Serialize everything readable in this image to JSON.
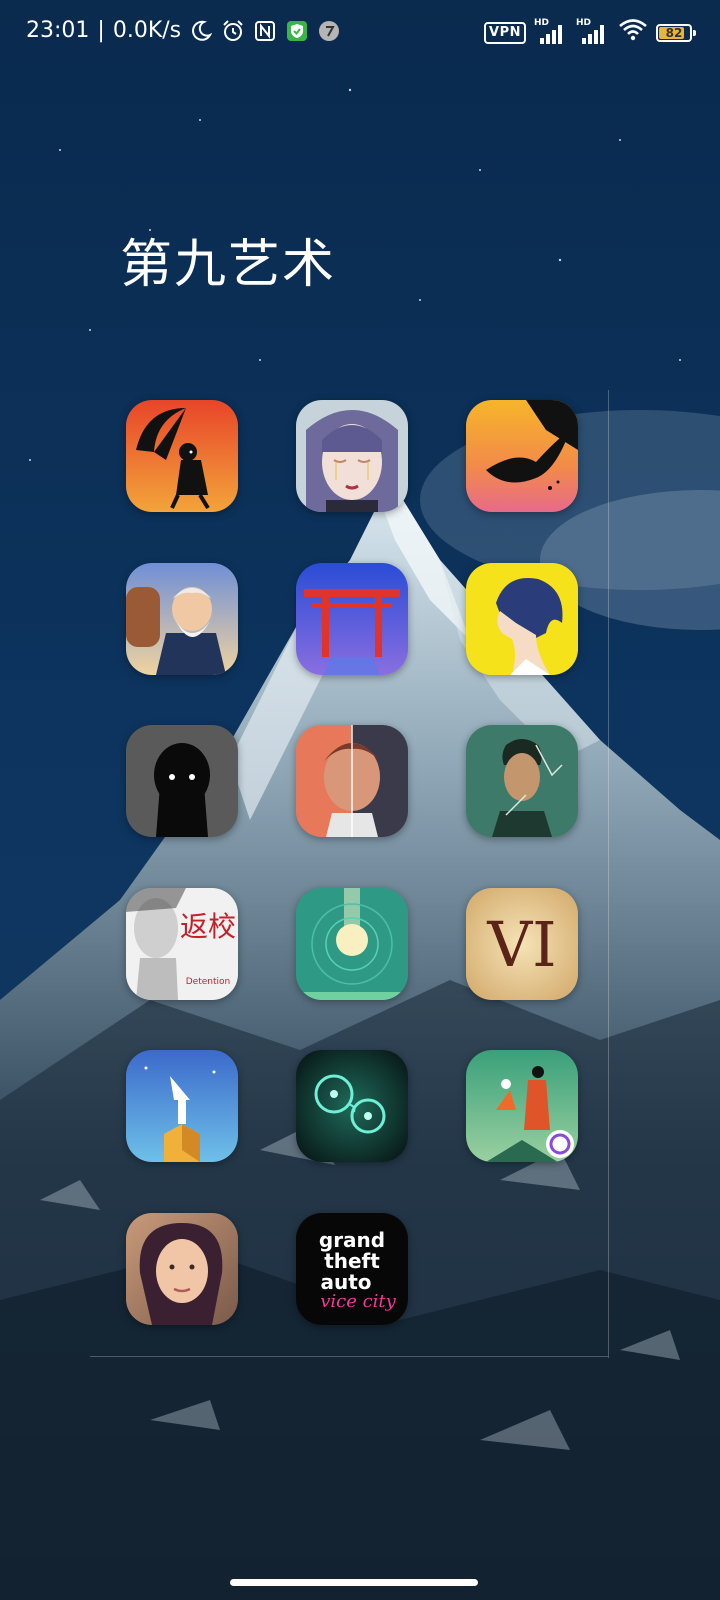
{
  "status_bar": {
    "time": "23:01",
    "net_speed": "0.0K/s",
    "vpn": "VPN",
    "sim1_tag": "HD",
    "sim2_tag": "HD",
    "battery": "82",
    "left_icons": [
      "moon-icon",
      "alarm-icon",
      "nfc-icon",
      "shield-check-icon",
      "app-notification-icon"
    ],
    "right_icons": [
      "signal-icon",
      "signal-icon",
      "wifi-icon",
      "battery-icon"
    ]
  },
  "folder": {
    "title": "第九艺术",
    "apps": [
      {
        "name": "umbrella-girl-game-icon"
      },
      {
        "name": "gris-game-icon"
      },
      {
        "name": "bird-silhouette-game-icon"
      },
      {
        "name": "old-mans-journey-icon"
      },
      {
        "name": "torii-gate-game-icon"
      },
      {
        "name": "florence-game-icon"
      },
      {
        "name": "limbo-game-icon"
      },
      {
        "name": "split-face-game-icon"
      },
      {
        "name": "cracked-portrait-game-icon"
      },
      {
        "name": "detention-game-icon",
        "label_cn": "返校",
        "label_en": "Detention"
      },
      {
        "name": "alto-moon-game-icon"
      },
      {
        "name": "civilization-vi-icon",
        "label": "VI"
      },
      {
        "name": "monument-valley-icon"
      },
      {
        "name": "osmos-cells-game-icon"
      },
      {
        "name": "monument-valley-2-icon"
      },
      {
        "name": "life-is-strange-icon"
      },
      {
        "name": "gta-vice-city-icon",
        "label_lines": [
          "grand",
          "theft",
          "auto"
        ],
        "label_script": "vice city"
      }
    ]
  }
}
